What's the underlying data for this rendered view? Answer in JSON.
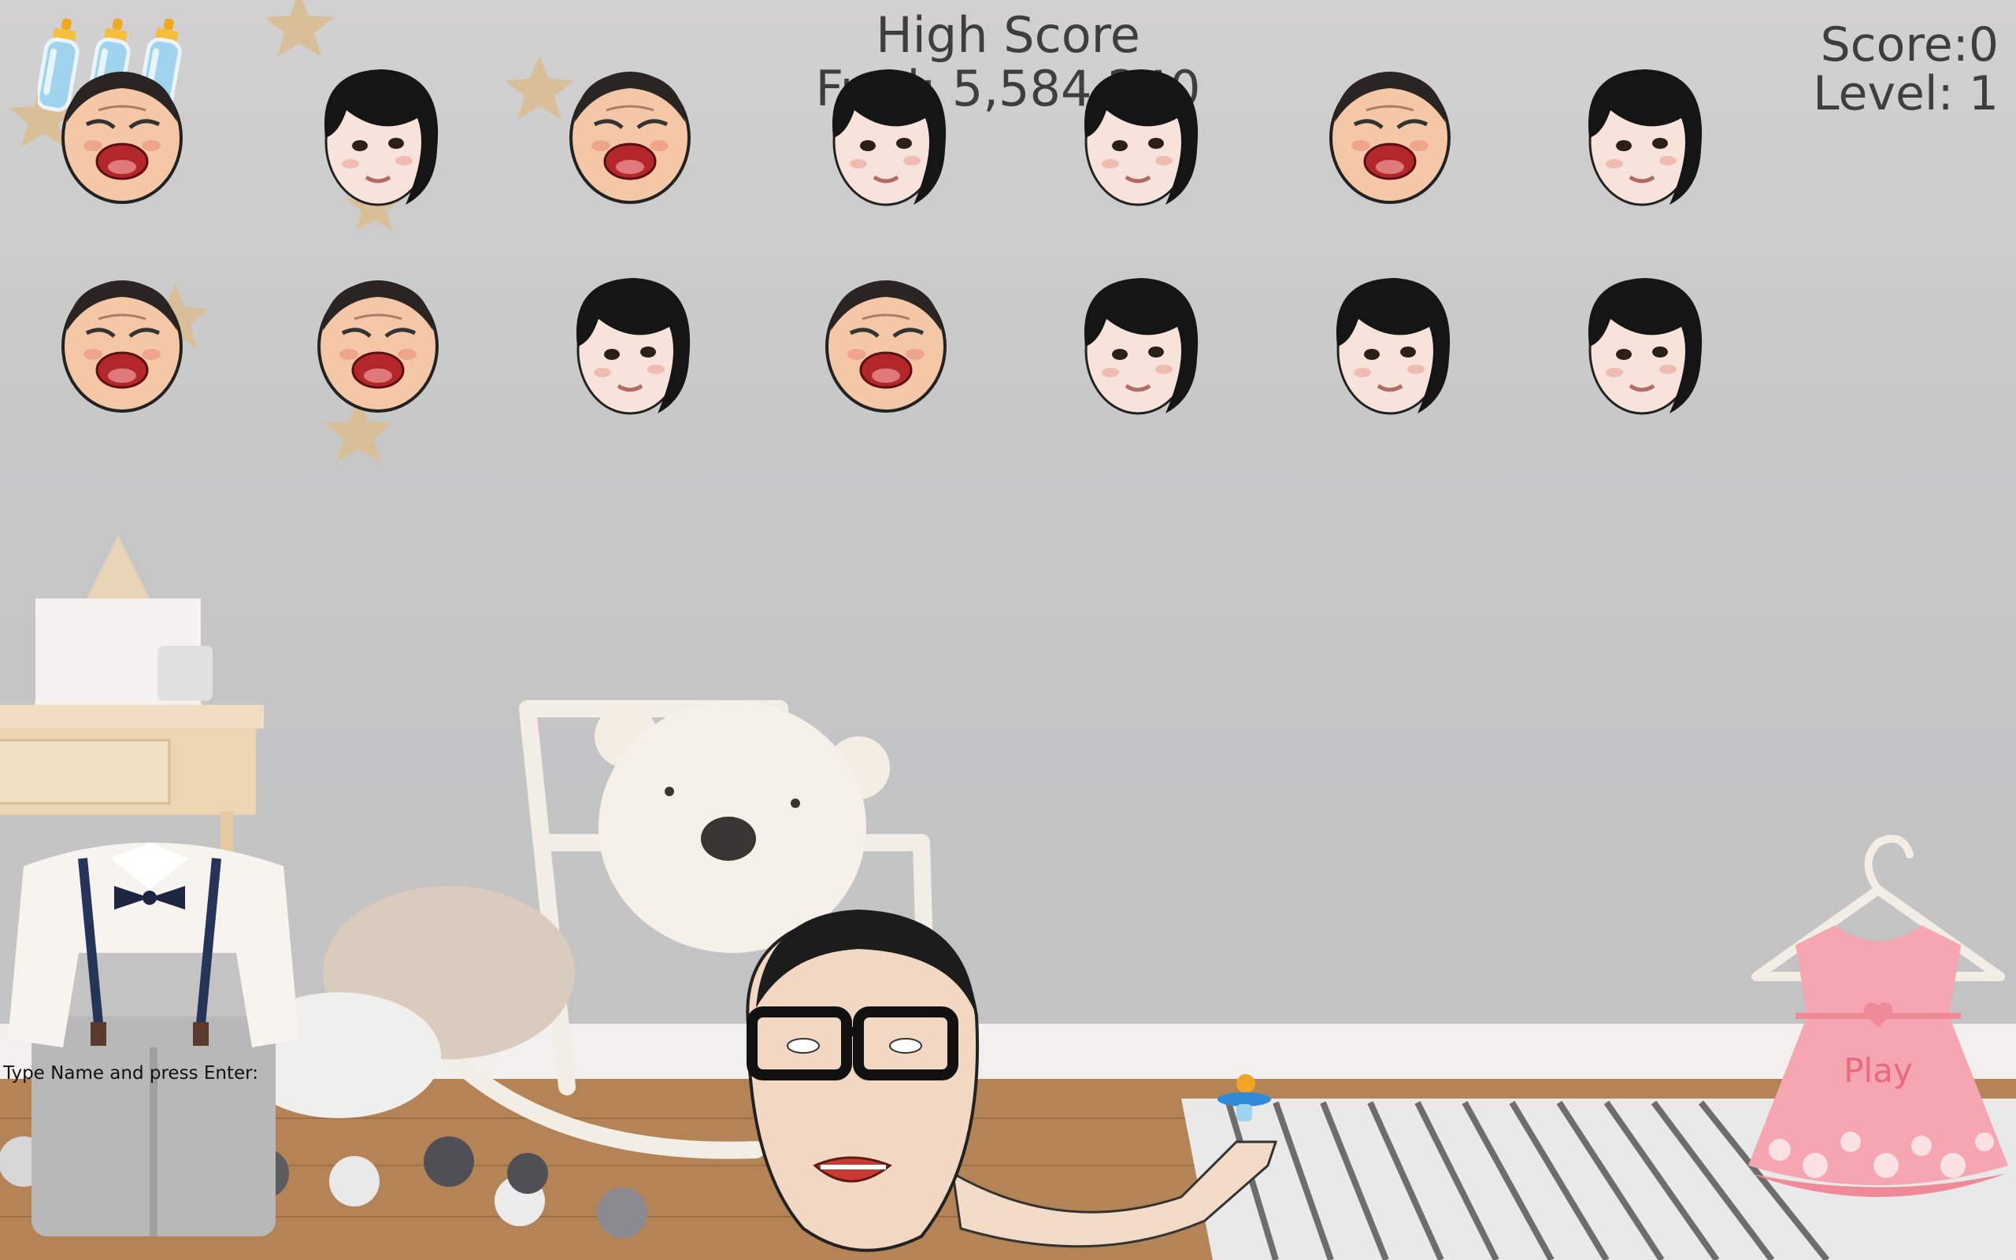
{
  "hud": {
    "high_score_label": "High Score",
    "high_score_value": "Fred: 5,584,240",
    "score_label": "Score:0",
    "level_label": "Level: 1"
  },
  "lives": {
    "count": 3,
    "icon": "baby-bottle-icon"
  },
  "name_prompt": "Type Name and press Enter:",
  "play_button": {
    "label": "Play"
  },
  "grid": {
    "rows": [
      [
        "crying",
        "girl",
        "crying",
        "girl",
        "girl",
        "crying",
        "girl"
      ],
      [
        "crying",
        "crying",
        "girl",
        "crying",
        "girl",
        "girl",
        "girl"
      ]
    ]
  },
  "colors": {
    "wall": "#c6c6c7",
    "floor": "#b58456",
    "hud_text": "#3e3e3e",
    "dress": "#f5a6b0",
    "play_text": "#e86a7c"
  }
}
